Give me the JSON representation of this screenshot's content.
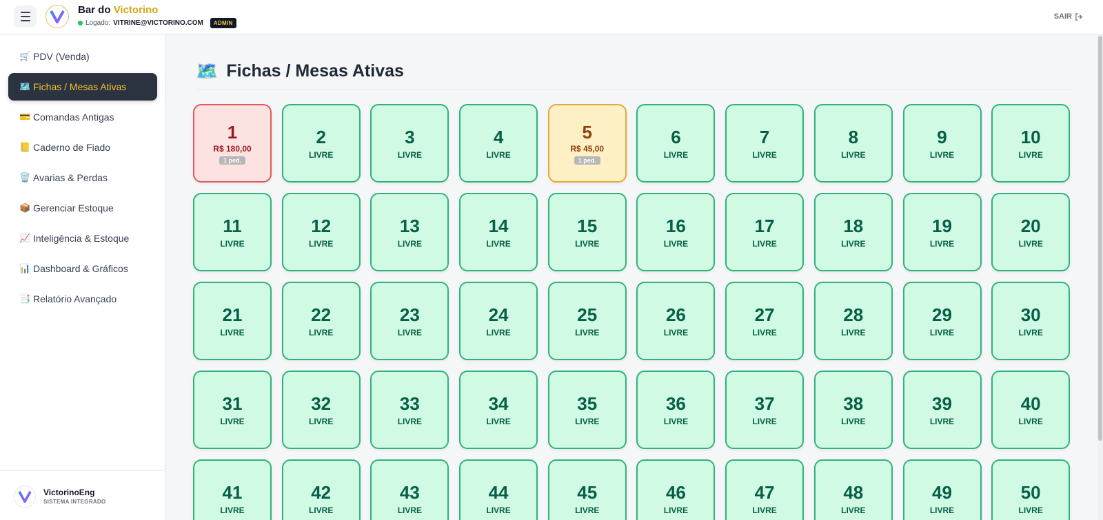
{
  "header": {
    "brand_prefix": "Bar do",
    "brand_accent": "Victorino",
    "login_label": "Logado:",
    "login_email": "VITRINE@VICTORINO.COM",
    "role_badge": "ADMIN",
    "logout_label": "SAIR"
  },
  "sidebar": {
    "items": [
      {
        "icon": "🛒",
        "label": "PDV (Venda)"
      },
      {
        "icon": "🗺️",
        "label": "Fichas / Mesas Ativas"
      },
      {
        "icon": "💳",
        "label": "Comandas Antigas"
      },
      {
        "icon": "📒",
        "label": "Caderno de Fiado"
      },
      {
        "icon": "🗑️",
        "label": "Avarias & Perdas"
      },
      {
        "icon": "📦",
        "label": "Gerenciar Estoque"
      },
      {
        "icon": "📈",
        "label": "Inteligência & Estoque"
      },
      {
        "icon": "📊",
        "label": "Dashboard & Gráficos"
      },
      {
        "icon": "📑",
        "label": "Relatório Avançado"
      }
    ],
    "active_index": 1,
    "footer": {
      "name": "VictorinoEng",
      "subtitle": "SISTEMA INTEGRADO"
    }
  },
  "main": {
    "title_icon": "🗺️",
    "title": "Fichas / Mesas Ativas",
    "free_label": "LIVRE",
    "occupied": {
      "1": {
        "amount": "R$ 180,00",
        "orders": "1 ped.",
        "state": "busy"
      },
      "5": {
        "amount": "R$ 45,00",
        "orders": "1 ped.",
        "state": "pending"
      }
    },
    "table_count": 50
  },
  "colors": {
    "accent": "#f2c230",
    "free_bg": "#d1fae5",
    "free_border": "#2fb37a",
    "busy_bg": "#fde2e2",
    "pending_bg": "#fdf0c4"
  }
}
